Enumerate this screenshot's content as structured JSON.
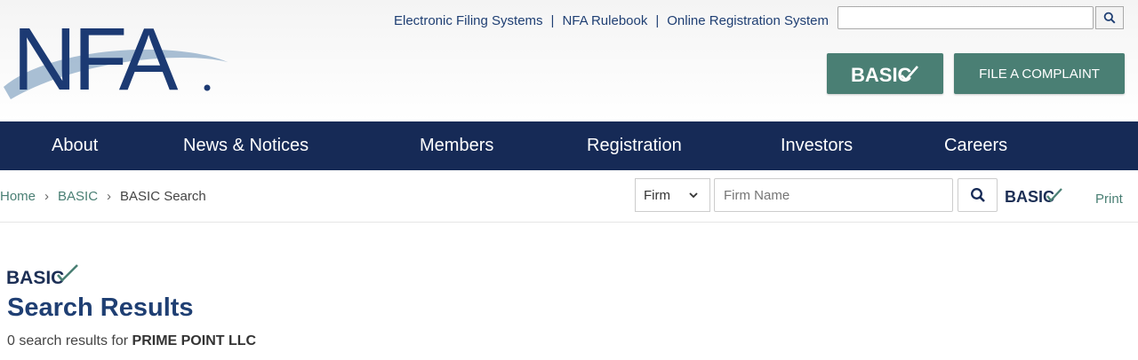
{
  "brand": {
    "logo_text": "NFA"
  },
  "top_links": [
    "Electronic Filing Systems",
    "NFA Rulebook",
    "Online Registration System"
  ],
  "header_buttons": {
    "basic_label": "BASIC",
    "complaint_label": "FILE A COMPLAINT"
  },
  "nav": [
    "About",
    "News & Notices",
    "Members",
    "Registration",
    "Investors",
    "Careers"
  ],
  "breadcrumb": {
    "home": "Home",
    "basic": "BASIC",
    "current": "BASIC Search"
  },
  "search": {
    "type_value": "Firm",
    "placeholder": "Firm Name"
  },
  "basic_mark": "BASIC",
  "print_label": "Print",
  "results": {
    "title": "Search Results",
    "count": "0",
    "prefix_text": " search results for ",
    "query": "PRIME POINT LLC"
  },
  "colors": {
    "navy": "#162a56",
    "teal": "#4a7f74",
    "blue_text": "#1f3f73"
  }
}
